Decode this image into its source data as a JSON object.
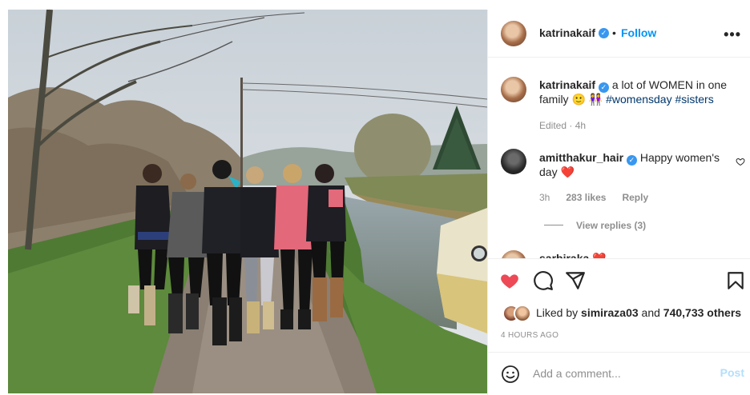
{
  "post_author": {
    "username": "katrinakaif",
    "verified": true,
    "follow_label": "Follow",
    "separator": "•",
    "more_label": "•••"
  },
  "caption": {
    "username": "katrinakaif",
    "text": "a lot of WOMEN in one family 🙂 👭",
    "hashtags": "#womensday #sisters",
    "meta": "Edited · 4h"
  },
  "comments": [
    {
      "username": "amitthakur_hair",
      "text": "Happy women's day ❤️",
      "time": "3h",
      "likes": "283 likes",
      "reply_label": "Reply",
      "view_replies": "View replies (3)"
    },
    {
      "username": "sarbiraka",
      "text": "❤️"
    }
  ],
  "likes": {
    "prefix": "Liked by",
    "user": "simiraza03",
    "middle": "and",
    "count": "740,733 others"
  },
  "timestamp": "4 HOURS AGO",
  "comment_box": {
    "placeholder": "Add a comment...",
    "post_label": "Post"
  },
  "icons": {
    "like": "heart-icon",
    "comment": "comment-icon",
    "share": "share-icon",
    "save": "bookmark-icon",
    "emoji": "emoji-icon",
    "more": "more-icon"
  },
  "colors": {
    "accent": "#0095f6",
    "liked_heart": "#ed4956",
    "verified": "#3897f0",
    "post_disabled": "#b2dffc"
  }
}
